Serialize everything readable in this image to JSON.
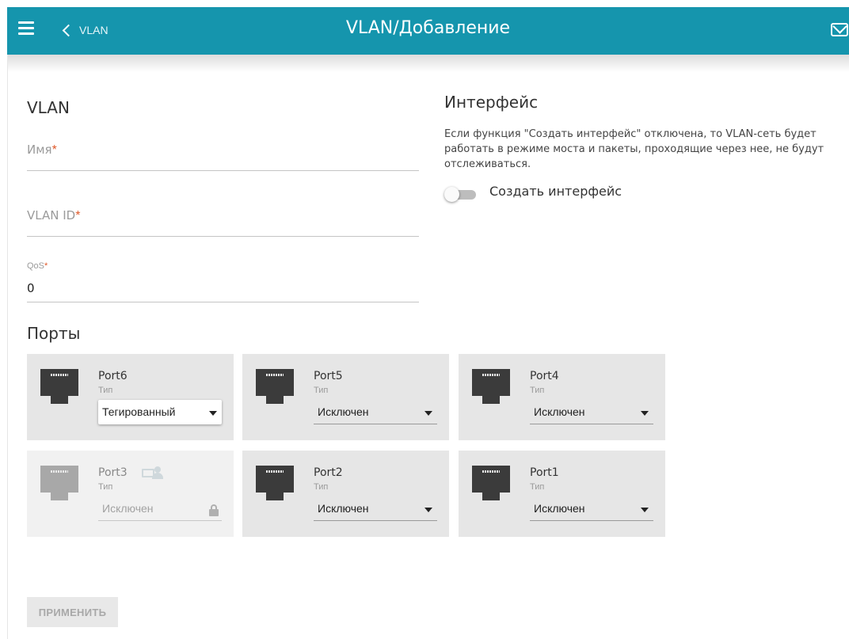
{
  "header": {
    "back_label": "VLAN",
    "title": "VLAN/Добавление",
    "bar_color": "#1595ad"
  },
  "vlan": {
    "heading": "VLAN",
    "name_label": "Имя",
    "vlan_id_label": "VLAN ID",
    "qos_label": "QoS",
    "qos_value": "0",
    "required_mark": "*"
  },
  "interface": {
    "heading": "Интерфейс",
    "description": "Если функция \"Создать интерфейс\" отключена, то VLAN-сеть будет работать в режиме моста и пакеты, проходящие через нее, не будут отслеживаться.",
    "toggle_label": "Создать интерфейс",
    "toggle_on": false
  },
  "ports": {
    "heading": "Порты",
    "type_label": "Тип",
    "items": [
      {
        "name": "Port6",
        "value": "Тегированный"
      },
      {
        "name": "Port5",
        "value": "Исключен"
      },
      {
        "name": "Port4",
        "value": "Исключен"
      },
      {
        "name": "Port3",
        "value": "Исключен",
        "disabled": true
      },
      {
        "name": "Port2",
        "value": "Исключен"
      },
      {
        "name": "Port1",
        "value": "Исключен"
      }
    ]
  },
  "actions": {
    "apply_label": "ПРИМЕНИТЬ"
  }
}
